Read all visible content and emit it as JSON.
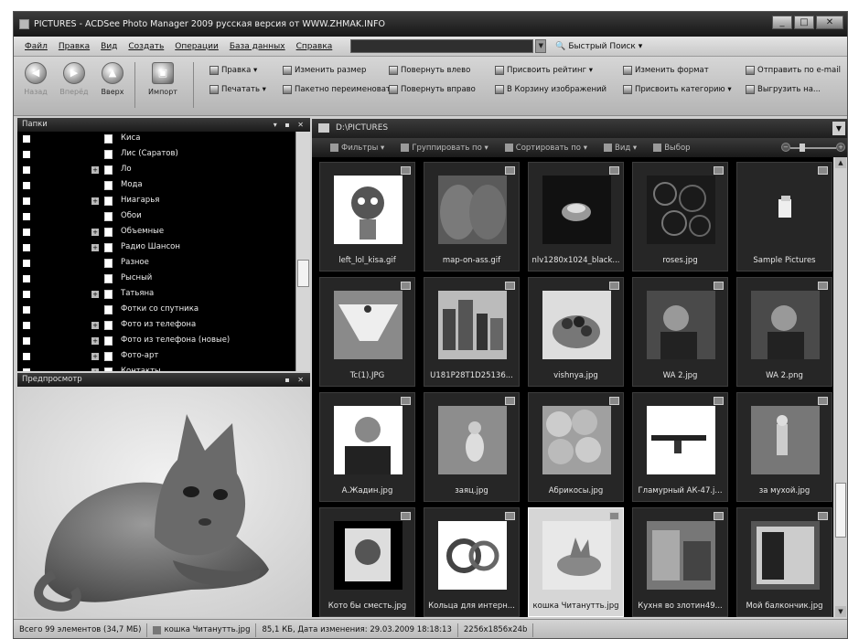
{
  "window": {
    "title": "PICTURES - ACDSee Photo Manager 2009 русская версия от WWW.ZHMAK.INFO",
    "controls": [
      "_",
      "□",
      "✕"
    ]
  },
  "menubar": {
    "items": [
      "Файл",
      "Правка",
      "Вид",
      "Создать",
      "Операции",
      "База данных",
      "Справка"
    ],
    "quick_search": "Быстрый Поиск"
  },
  "toolbar": {
    "nav": {
      "back": "Назад",
      "forward": "Вперёд",
      "up": "Вверх",
      "import": "Импорт"
    },
    "tools": [
      "Правка",
      "Печатать",
      "Изменить размер",
      "Пакетно переименовать",
      "Повернуть влево",
      "Повернуть вправо",
      "Присвоить рейтинг",
      "В Корзину изображений",
      "Изменить формат",
      "Присвоить категорию",
      "Отправить по e-mail",
      "Выгрузить на..."
    ]
  },
  "folders": {
    "title": "Папки",
    "items": [
      {
        "label": "Киса",
        "expander": ""
      },
      {
        "label": "Лис (Саратов)",
        "expander": ""
      },
      {
        "label": "Ло",
        "expander": "+"
      },
      {
        "label": "Мода",
        "expander": ""
      },
      {
        "label": "Ниагарья",
        "expander": "+"
      },
      {
        "label": "Обои",
        "expander": ""
      },
      {
        "label": "Объемные",
        "expander": "+"
      },
      {
        "label": "Радио Шансон",
        "expander": "+"
      },
      {
        "label": "Разное",
        "expander": ""
      },
      {
        "label": "Рысный",
        "expander": ""
      },
      {
        "label": "Татьяна",
        "expander": "+"
      },
      {
        "label": "Фотки со спутника",
        "expander": ""
      },
      {
        "label": "Фото из телефона",
        "expander": "+"
      },
      {
        "label": "Фото из телефона (новые)",
        "expander": "+"
      },
      {
        "label": "Фото-арт",
        "expander": "+"
      },
      {
        "label": "Контакты",
        "expander": "+"
      }
    ]
  },
  "preview": {
    "title": "Предпросмотр"
  },
  "path": "D:\\PICTURES",
  "viewbar": {
    "items": [
      "Фильтры",
      "Группировать по",
      "Сортировать по",
      "Вид",
      "Выбор"
    ]
  },
  "files": [
    {
      "name": "left_lol_kisa.gif",
      "selected": false
    },
    {
      "name": "map-on-ass.gif",
      "selected": false
    },
    {
      "name": "nlv1280x1024_black...",
      "selected": false
    },
    {
      "name": "roses.jpg",
      "selected": false
    },
    {
      "name": "Sample Pictures",
      "selected": false
    },
    {
      "name": "Tc(1).JPG",
      "selected": false
    },
    {
      "name": "U181P28T1D25136...",
      "selected": false
    },
    {
      "name": "vishnya.jpg",
      "selected": false
    },
    {
      "name": "WA 2.jpg",
      "selected": false
    },
    {
      "name": "WA 2.png",
      "selected": false
    },
    {
      "name": "А.Жадин.jpg",
      "selected": false
    },
    {
      "name": "заяц.jpg",
      "selected": false
    },
    {
      "name": "Абрикосы.jpg",
      "selected": false
    },
    {
      "name": "Гламурный АК-47.j...",
      "selected": false
    },
    {
      "name": "за мухой.jpg",
      "selected": false
    },
    {
      "name": "Кото бы сместь.jpg",
      "selected": false
    },
    {
      "name": "Кольца для интерн...",
      "selected": false
    },
    {
      "name": "кошка Читанутть.jpg",
      "selected": true
    },
    {
      "name": "Кухня во злотин49...",
      "selected": false
    },
    {
      "name": "Мой балкончик.jpg",
      "selected": false
    }
  ],
  "status": {
    "total": "Всего 99 элементов",
    "size": "(34,7 МБ)",
    "file": "кошка Читанутть.jpg",
    "info": "85,1 КБ, Дата изменения: 29.03.2009 18:18:13",
    "dims": "2256x1856x24b"
  },
  "colors": {
    "pane_dark": "#000000",
    "tile_bg": "#262626",
    "chrome": "#cfcfcf"
  }
}
